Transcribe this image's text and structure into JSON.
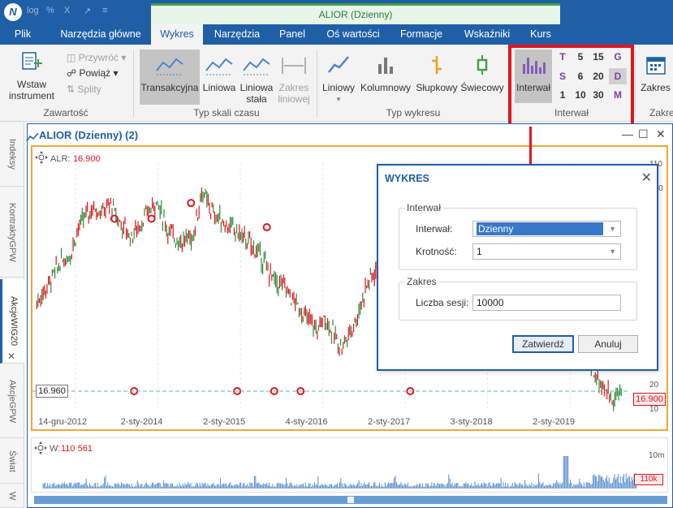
{
  "window": {
    "title": "ALIOR (Dzienny)",
    "qa_icons": [
      "log",
      "%",
      "X",
      "↗",
      "≡"
    ]
  },
  "ribbon_tabs": [
    {
      "label": "Plik",
      "active": false
    },
    {
      "label": "Narzędzia główne",
      "active": false
    },
    {
      "label": "Wykres",
      "active": true
    },
    {
      "label": "Narzędzia",
      "active": false
    },
    {
      "label": "Panel",
      "active": false
    },
    {
      "label": "Oś wartości",
      "active": false
    },
    {
      "label": "Formacje",
      "active": false
    },
    {
      "label": "Wskaźniki",
      "active": false
    },
    {
      "label": "Kurs",
      "active": false
    }
  ],
  "ribbon": {
    "zawartosc": {
      "wstaw_label": "Wstaw instrument",
      "przywroc": "Przywróć",
      "powiaz": "Powiąż",
      "splity": "Splity",
      "group": "Zawartość"
    },
    "typ_skali": {
      "transakcyjna": "Transakcyjna",
      "liniowa": "Liniowa",
      "liniowa_stala": "Liniowa stała",
      "zakres_liniowej": "Zakres liniowej",
      "group": "Typ skali czasu"
    },
    "typ_wykresu": {
      "liniowy": "Liniowy",
      "kolumnowy": "Kolumnowy",
      "slupkowy": "Słupkowy",
      "swiecowy": "Świecowy",
      "group": "Typ wykresu"
    },
    "interwal": {
      "button": "Interwał",
      "grid": [
        "T",
        "5",
        "15",
        "G",
        "S",
        "6",
        "20",
        "D",
        "1",
        "10",
        "30",
        "M"
      ],
      "selected": "D",
      "group": "Interwał"
    },
    "zakres": {
      "button": "Zakres",
      "group": "Zakre"
    }
  },
  "side_tabs": [
    "Indeksy",
    "KontraktyGPW",
    "AkcjeWIG20",
    "AkcjeGPW",
    "Świat",
    "W"
  ],
  "chart_window": {
    "title": "ALIOR (Dzienny) (2)",
    "symbol": "ALR:",
    "last_price": "16.900",
    "cursor_price": "16.960",
    "price_label_right": "16.900",
    "volume_label": "W:",
    "volume_value": "110 561",
    "volume_right": "110k",
    "volume_top_tick": "10m"
  },
  "chart_data": {
    "type": "line",
    "x_ticks": [
      "14-gru-2012",
      "2-sty-2014",
      "2-sty-2015",
      "4-sty-2016",
      "2-sty-2017",
      "3-sty-2018",
      "2-sty-2019"
    ],
    "y_ticks": [
      "110",
      "100",
      "90",
      "80",
      "70",
      "60",
      "50",
      "40",
      "30",
      "20",
      "10"
    ],
    "ylim": [
      10,
      110
    ],
    "price_path": [
      [
        2013.0,
        53
      ],
      [
        2013.1,
        58
      ],
      [
        2013.2,
        64
      ],
      [
        2013.3,
        70
      ],
      [
        2013.4,
        72
      ],
      [
        2013.5,
        83
      ],
      [
        2013.6,
        89
      ],
      [
        2013.7,
        92
      ],
      [
        2013.8,
        90
      ],
      [
        2013.9,
        93
      ],
      [
        2014.0,
        86
      ],
      [
        2014.15,
        80
      ],
      [
        2014.3,
        87
      ],
      [
        2014.45,
        95
      ],
      [
        2014.6,
        82
      ],
      [
        2014.75,
        78
      ],
      [
        2014.9,
        80
      ],
      [
        2015.0,
        98
      ],
      [
        2015.15,
        89
      ],
      [
        2015.3,
        85
      ],
      [
        2015.5,
        80
      ],
      [
        2015.7,
        73
      ],
      [
        2015.9,
        61
      ],
      [
        2016.0,
        60
      ],
      [
        2016.1,
        55
      ],
      [
        2016.2,
        50
      ],
      [
        2016.4,
        42
      ],
      [
        2016.5,
        47
      ],
      [
        2016.6,
        40
      ],
      [
        2016.7,
        35
      ],
      [
        2016.8,
        41
      ],
      [
        2016.9,
        48
      ],
      [
        2017.0,
        60
      ],
      [
        2017.2,
        71
      ],
      [
        2017.4,
        74
      ],
      [
        2017.5,
        68
      ],
      [
        2017.6,
        72
      ],
      [
        2017.8,
        62
      ],
      [
        2018.0,
        65
      ],
      [
        2018.5,
        60
      ],
      [
        2019.0,
        55
      ],
      [
        2019.4,
        45
      ],
      [
        2019.6,
        35
      ],
      [
        2019.8,
        23
      ],
      [
        2019.9,
        17
      ],
      [
        2020.0,
        14
      ],
      [
        2020.1,
        16.9
      ]
    ],
    "markers_x": [
      2013.1,
      2014.35,
      2014.8,
      2015.12,
      2016.45
    ],
    "guideline_value": 16.96
  },
  "dialog": {
    "title": "WYKRES",
    "interval_group": "Interwał",
    "interval_label": "Interwał:",
    "interval_value": "Dzienny",
    "multiplicity_label": "Krotność:",
    "multiplicity_value": "1",
    "range_group": "Zakres",
    "sessions_label": "Liczba sesji:",
    "sessions_value": "10000",
    "confirm": "Zatwierdź",
    "cancel": "Anuluj"
  },
  "colors": {
    "brand": "#1f5fa6",
    "highlight": "#e0161d",
    "candle_up": "#2e8b3a",
    "candle_down": "#e0161d",
    "chart_border": "#f0a830"
  }
}
